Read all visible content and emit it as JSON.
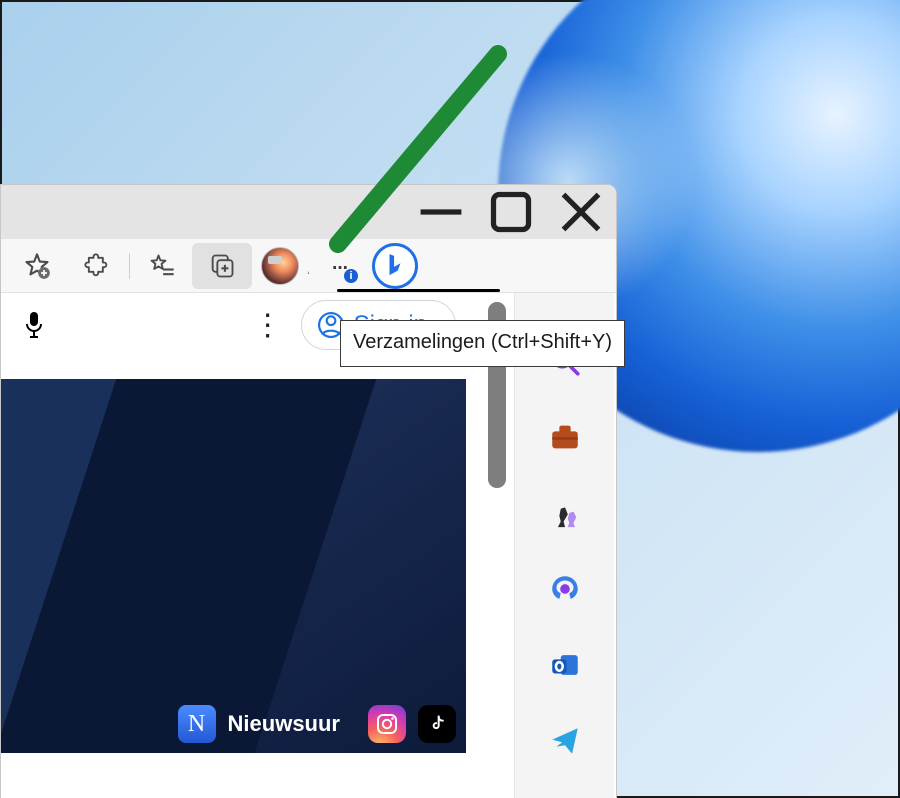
{
  "window_controls": {
    "min": "—",
    "max": "☐",
    "close": "✕"
  },
  "tooltip_text": "Verzamelingen (Ctrl+Shift+Y)",
  "signin_label": "Sign in",
  "channel_label": "Nieuwsuur",
  "channel_tile_letter": "N",
  "settings_badge": "i",
  "toolbar_icons": {
    "add_favorite": "add-favorite",
    "extensions": "extensions",
    "favorites_list": "favorites-list",
    "collections": "collections",
    "profile": "profile",
    "more": "settings-and-more",
    "bing": "bing-chat"
  }
}
